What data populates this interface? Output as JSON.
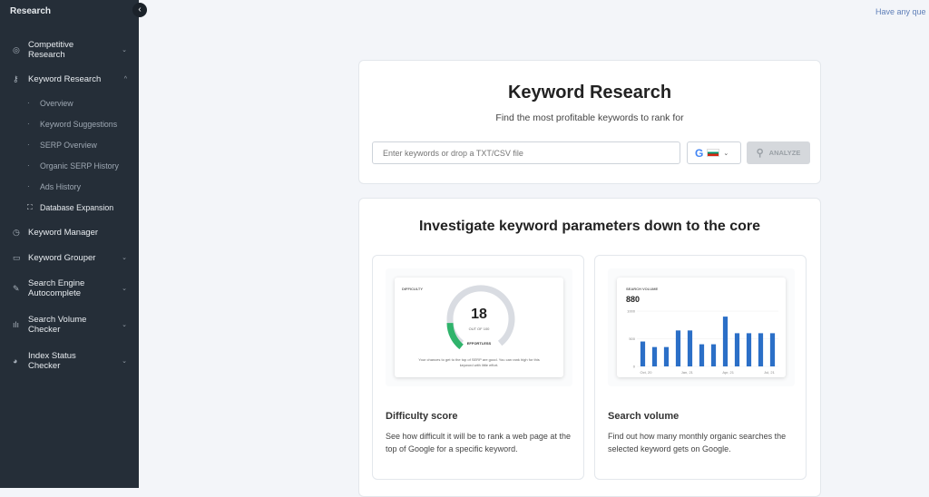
{
  "sidebar": {
    "title": "Research",
    "items": [
      {
        "label1": "Competitive",
        "label2": "Research",
        "icon": "target-icon"
      },
      {
        "label": "Keyword Research",
        "icon": "key-icon"
      },
      {
        "label": "Keyword Manager",
        "icon": "clock-icon"
      },
      {
        "label": "Keyword Grouper",
        "icon": "folder-icon"
      },
      {
        "label1": "Search Engine",
        "label2": "Autocomplete",
        "icon": "pen-icon"
      },
      {
        "label1": "Search Volume",
        "label2": "Checker",
        "icon": "bar-chart-icon"
      },
      {
        "label1": "Index Status",
        "label2": "Checker",
        "icon": "pie-icon"
      }
    ],
    "subitems": [
      "Overview",
      "Keyword Suggestions",
      "SERP Overview",
      "Organic SERP History",
      "Ads History",
      "Database Expansion"
    ]
  },
  "header": {
    "help_link": "Have any que"
  },
  "search": {
    "title": "Keyword Research",
    "subtitle": "Find the most profitable keywords to rank for",
    "placeholder": "Enter keywords or drop a TXT/CSV file",
    "engine": "G",
    "analyze": "ANALYZE"
  },
  "features": {
    "title": "Investigate keyword parameters down to the core",
    "difficulty": {
      "label": "DIFFICULTY",
      "score": "18",
      "out_of": "OUT OF 100",
      "score_value": 18,
      "level": "EFFORTLESS",
      "note": "Your chances to get to the top of SERP are good. You can rank high for this keyword with little effort.",
      "title": "Difficulty score",
      "desc": "See how difficult it will be to rank a web page at the top of Google for a specific keyword."
    },
    "volume": {
      "label": "SEARCH VOLUME",
      "value": "880",
      "title": "Search volume",
      "desc": "Find out how many monthly organic searches the selected keyword gets on Google."
    }
  },
  "chart_data": {
    "type": "bar",
    "yticks": [
      "1000",
      "500",
      "0"
    ],
    "ylim": [
      0,
      1000
    ],
    "xticks": [
      "Oct, 20",
      "Jan, 21",
      "Apr, 21",
      "Jul, 21"
    ],
    "values": [
      450,
      350,
      350,
      650,
      650,
      400,
      400,
      900,
      600,
      600,
      600,
      600
    ],
    "color": "#2b6fc7"
  },
  "colors": {
    "sidebar": "#252e38",
    "accent_green": "#2fb36b",
    "bar": "#2b6fc7"
  }
}
